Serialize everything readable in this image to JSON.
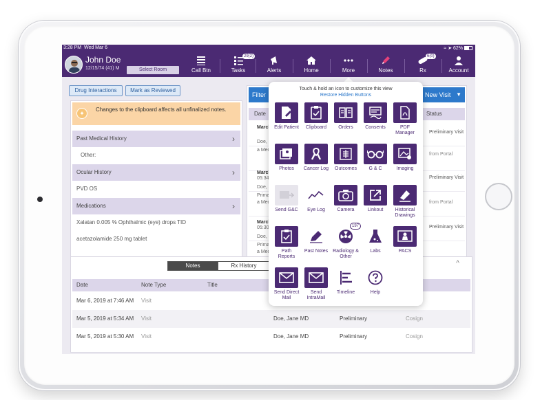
{
  "status": {
    "time": "3:28 PM",
    "day": "Wed Mar 6",
    "battery": "62%"
  },
  "patient": {
    "name": "John Doe",
    "info": "12/15/74 (41) M",
    "select_room": "Select Room"
  },
  "nav": [
    {
      "label": "Call Btn",
      "icon": "call-list-icon",
      "badge": ""
    },
    {
      "label": "Tasks",
      "icon": "tasks-icon",
      "badge": "29(2)"
    },
    {
      "label": "Alerts",
      "icon": "megaphone-icon",
      "badge": ""
    },
    {
      "label": "Home",
      "icon": "home-icon",
      "badge": ""
    },
    {
      "label": "More",
      "icon": "more-dots-icon",
      "badge": ""
    },
    {
      "label": "Notes",
      "icon": "pen-icon",
      "badge": ""
    },
    {
      "label": "Rx",
      "icon": "pill-icon",
      "badge": "6(0)"
    },
    {
      "label": "Account",
      "icon": "person-icon",
      "badge": ""
    }
  ],
  "toolbar": {
    "drug_interactions": "Drug Interactions",
    "mark_reviewed": "Mark as Reviewed"
  },
  "clipboard": {
    "notice": "Changes to the clipboard affects all unfinalized notes.",
    "sections": [
      {
        "title": "Past Medical History",
        "rows": [
          "Other:"
        ]
      },
      {
        "title": "Ocular History",
        "rows": [
          "PVD OS"
        ]
      },
      {
        "title": "Medications",
        "rows": [
          "Xalatan 0.005 % Ophthalmic (eye) drops TID",
          "acetazolamide 250 mg tablet"
        ]
      }
    ]
  },
  "visits": {
    "filter": "Filter",
    "new_visit": "New Visit",
    "col_date": "Date",
    "col_status": "Status",
    "rows": [
      {
        "date": "March",
        "sub1": "Doe, J",
        "sub2": "Primar",
        "status": "Preliminary Visit"
      },
      {
        "date": "",
        "sub1": "a Medi",
        "sub2": "",
        "status": "from Portal"
      },
      {
        "date": "March",
        "sub1": "05:34",
        "sub2": "Doe, J",
        "status": "Preliminary Visit"
      },
      {
        "date": "",
        "sub1": "Primar",
        "sub2": "a Medi",
        "status": "from Portal"
      },
      {
        "date": "March",
        "sub1": "05:30",
        "sub2": "Doe, J",
        "status": "Preliminary Visit"
      },
      {
        "date": "",
        "sub1": "Primar",
        "sub2": "a Medi",
        "status": ""
      }
    ]
  },
  "bottom": {
    "tabs": [
      "Notes",
      "Rx History"
    ],
    "collapse_glyph": "^",
    "headers": {
      "date": "Date",
      "type": "Note Type",
      "title": "Title"
    },
    "rows": [
      {
        "date": "Mar 6, 2019 at 7:46 AM",
        "type": "Visit",
        "provider": "",
        "status": "",
        "action": ""
      },
      {
        "date": "Mar 5, 2019 at 5:34 AM",
        "type": "Visit",
        "provider": "Doe, Jane MD",
        "status": "Preliminary",
        "action": "Cosign"
      },
      {
        "date": "Mar 5, 2019 at 5:30 AM",
        "type": "Visit",
        "provider": "Doe, Jane MD",
        "status": "Preliminary",
        "action": "Cosign"
      }
    ]
  },
  "popover": {
    "title": "Touch & hold an icon to customize this view",
    "link": "Restore Hidden Buttons",
    "tiles": [
      {
        "label": "Edit Patient",
        "icon": "edit-patient-icon",
        "badge": ""
      },
      {
        "label": "Clipboard",
        "icon": "clipboard-icon",
        "badge": ""
      },
      {
        "label": "Orders",
        "icon": "orders-icon",
        "badge": ""
      },
      {
        "label": "Consents",
        "icon": "consents-icon",
        "badge": ""
      },
      {
        "label": "PDF Manager",
        "icon": "pdf-icon",
        "badge": ""
      },
      {
        "label": "Photos",
        "icon": "photos-icon",
        "badge": ""
      },
      {
        "label": "Cancer Log",
        "icon": "ribbon-icon",
        "badge": ""
      },
      {
        "label": "Outcomes",
        "icon": "outcomes-icon",
        "badge": ""
      },
      {
        "label": "G & C",
        "icon": "glasses-icon",
        "badge": ""
      },
      {
        "label": "Imaging",
        "icon": "imaging-icon",
        "badge": ""
      },
      {
        "label": "Send G&C",
        "icon": "send-gc-icon",
        "badge": ""
      },
      {
        "label": "Eye Log",
        "icon": "eye-log-icon",
        "badge": ""
      },
      {
        "label": "Camera",
        "icon": "camera-icon",
        "badge": ""
      },
      {
        "label": "Linkout",
        "icon": "linkout-icon",
        "badge": ""
      },
      {
        "label": "Historical Drawings",
        "icon": "drawing-icon",
        "badge": ""
      },
      {
        "label": "Path Reports",
        "icon": "path-report-icon",
        "badge": ""
      },
      {
        "label": "Past Notes",
        "icon": "past-notes-icon",
        "badge": ""
      },
      {
        "label": "Radiology & Other",
        "icon": "radiology-icon",
        "badge": "197"
      },
      {
        "label": "Labs",
        "icon": "labs-icon",
        "badge": ""
      },
      {
        "label": "PACS",
        "icon": "pacs-icon",
        "badge": ""
      },
      {
        "label": "Send Direct Mail",
        "icon": "mail-icon",
        "badge": ""
      },
      {
        "label": "Send IntraMail",
        "icon": "mail-icon",
        "badge": ""
      },
      {
        "label": "Timeline",
        "icon": "timeline-icon",
        "badge": ""
      },
      {
        "label": "Help",
        "icon": "help-icon",
        "badge": ""
      }
    ]
  },
  "colors": {
    "brand_purple": "#4b2a73",
    "accent_blue": "#2d79cb",
    "notice_orange": "#fbd5a6",
    "section_lavender": "#dcd6ea"
  }
}
